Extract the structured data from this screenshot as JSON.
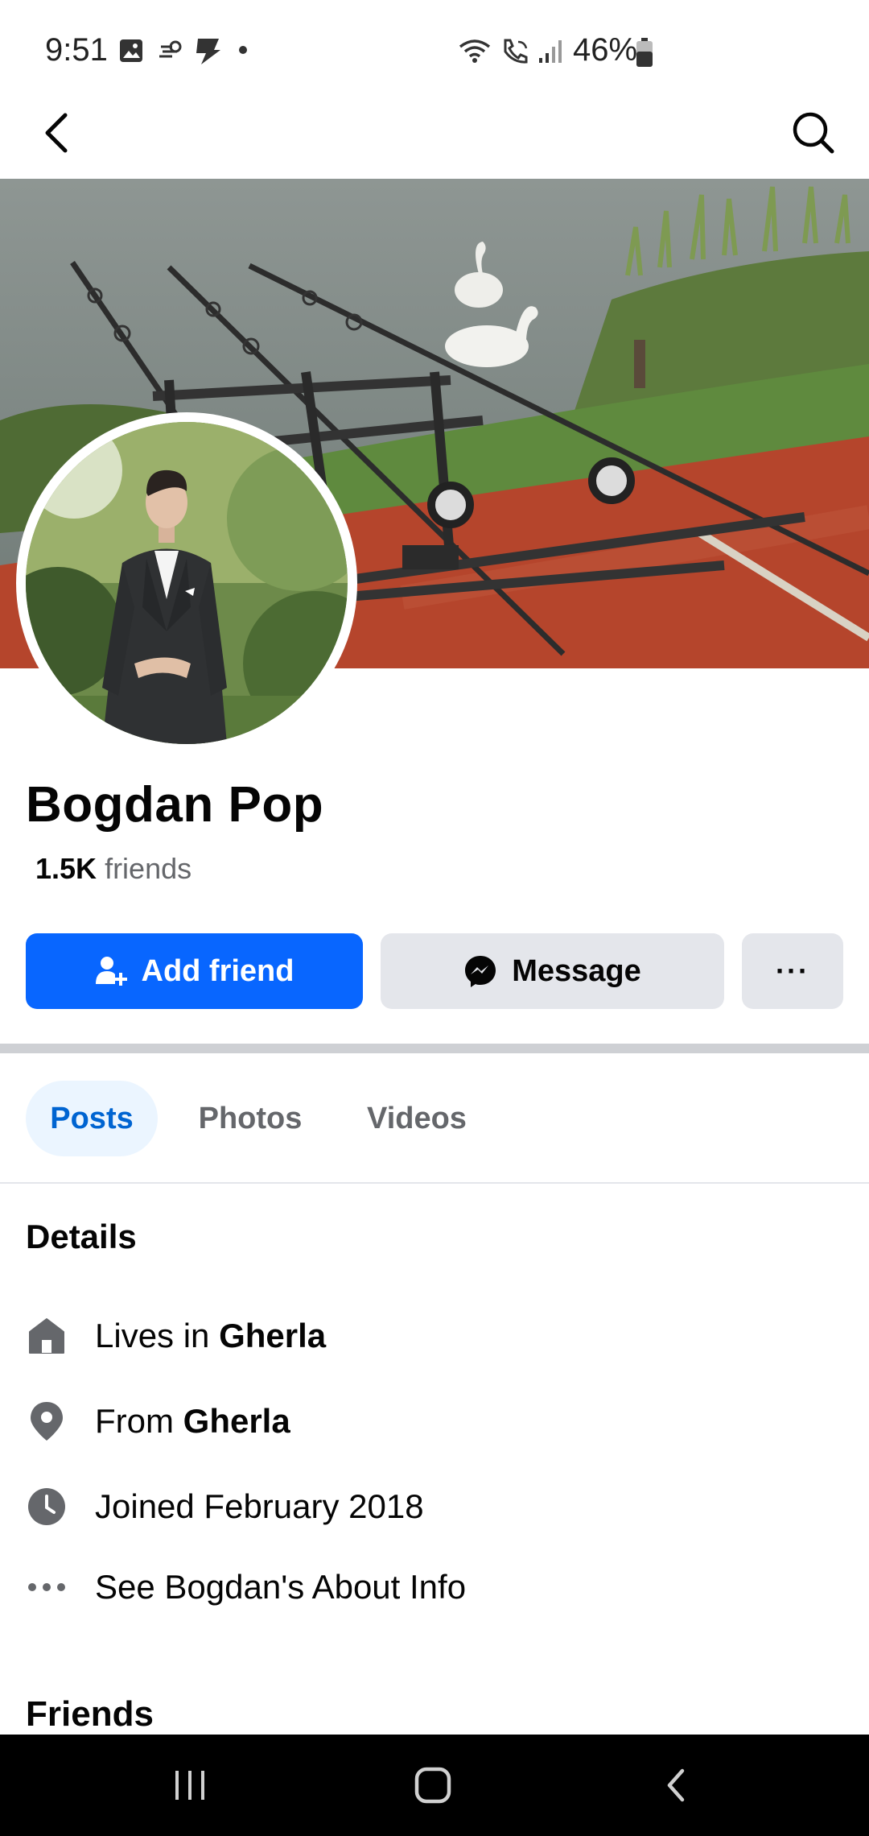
{
  "status_bar": {
    "time": "9:51",
    "battery": "46%",
    "icons": [
      "gallery-icon",
      "weather-icon",
      "app-icon",
      "dot-icon",
      "wifi-icon",
      "wifi-calling-icon",
      "signal-icon",
      "battery-icon"
    ]
  },
  "nav": {
    "back_icon": "back-arrow-icon",
    "search_icon": "search-icon"
  },
  "profile": {
    "name": "Bogdan Pop",
    "friends_count": "1.5K",
    "friends_label": "friends"
  },
  "actions": {
    "add_friend": "Add friend",
    "message": "Message",
    "more": "···"
  },
  "tabs": [
    {
      "label": "Posts",
      "active": true
    },
    {
      "label": "Photos",
      "active": false
    },
    {
      "label": "Videos",
      "active": false
    }
  ],
  "details": {
    "title": "Details",
    "lives_prefix": "Lives in ",
    "lives_city": "Gherla",
    "from_prefix": "From ",
    "from_city": "Gherla",
    "joined": "Joined February 2018",
    "about": "See Bogdan's About Info"
  },
  "friends_section": {
    "title": "Friends"
  },
  "colors": {
    "primary_blue": "#0866ff",
    "secondary_gray": "#e4e6eb",
    "active_tab_bg": "#ebf5ff",
    "active_tab_text": "#0064d1",
    "muted_text": "#65676b"
  }
}
